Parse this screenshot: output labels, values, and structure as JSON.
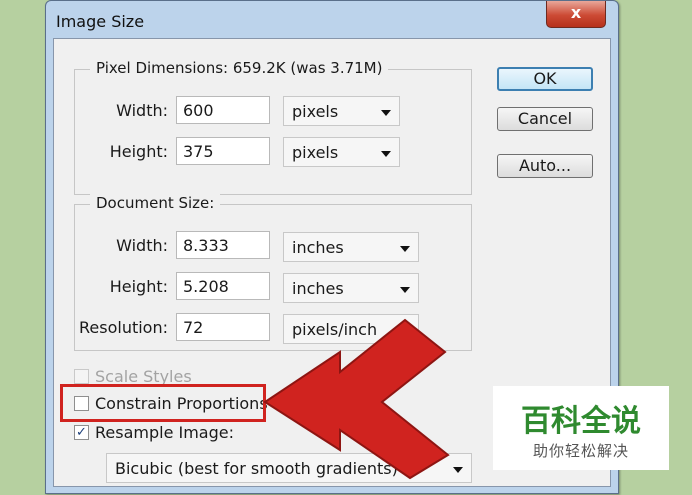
{
  "window": {
    "title": "Image Size",
    "close_glyph": "x"
  },
  "pixel_dimensions": {
    "legend": "Pixel Dimensions:  659.2K (was 3.71M)",
    "width_label": "Width:",
    "width_value": "600",
    "width_unit": "pixels",
    "height_label": "Height:",
    "height_value": "375",
    "height_unit": "pixels"
  },
  "document_size": {
    "legend": "Document Size:",
    "width_label": "Width:",
    "width_value": "8.333",
    "width_unit": "inches",
    "height_label": "Height:",
    "height_value": "5.208",
    "height_unit": "inches",
    "resolution_label": "Resolution:",
    "resolution_value": "72",
    "resolution_unit": "pixels/inch"
  },
  "buttons": {
    "ok": "OK",
    "cancel": "Cancel",
    "auto": "Auto..."
  },
  "options": {
    "scale_styles": {
      "label": "Scale Styles",
      "checked": false,
      "enabled": false
    },
    "constrain_proportions": {
      "label": "Constrain Proportions",
      "checked": false
    },
    "resample_image": {
      "label": "Resample Image:",
      "checked": true
    },
    "resample_method": "Bicubic (best for smooth gradients)"
  },
  "annotation": {
    "arrow_color": "#d0231f",
    "highlight_color": "#d0231f"
  },
  "watermark": {
    "title": "百科全说",
    "subtitle": "助你轻松解决"
  }
}
